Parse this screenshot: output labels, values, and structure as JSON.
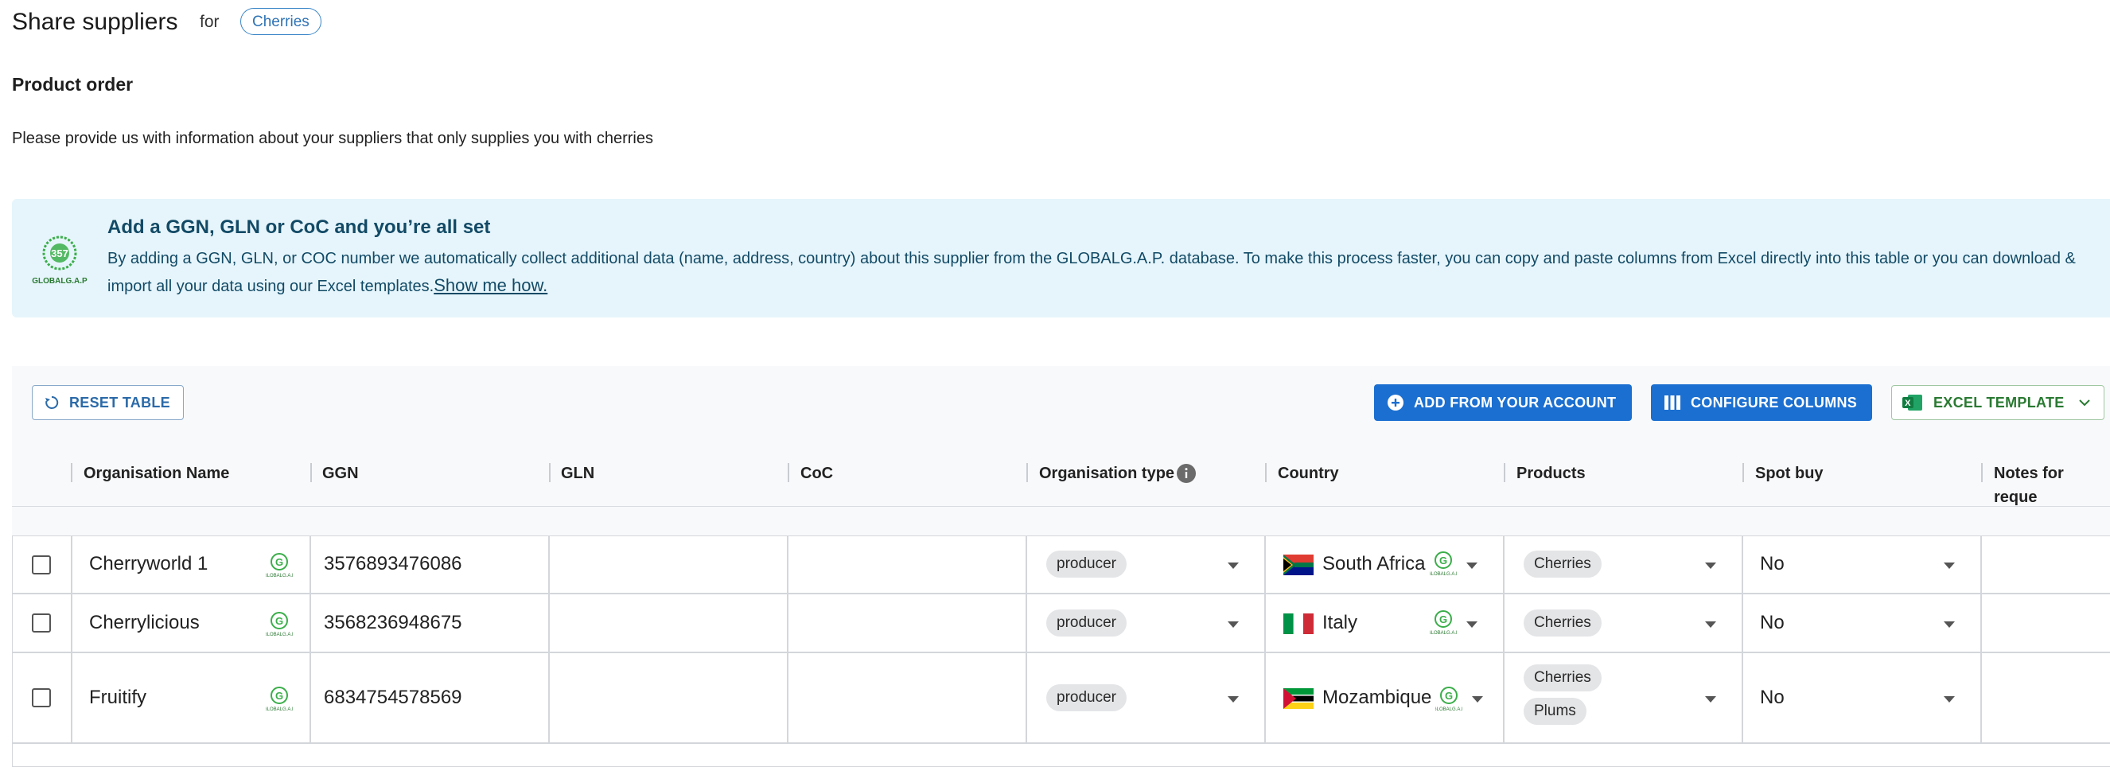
{
  "header": {
    "title": "Share suppliers",
    "for_label": "for",
    "product_chip": "Cherries"
  },
  "section": {
    "title": "Product order",
    "description": "Please provide us with information about your suppliers that only supplies you with cherries"
  },
  "banner": {
    "title": "Add a GGN, GLN or CoC and you’re all set",
    "text": "By adding a GGN, GLN, or COC number we automatically collect additional data (name, address, country) about this supplier from the GLOBALG.A.P. database. To make this process faster, you can copy and paste columns from Excel directly into this table or you can download & import all your data using our Excel templates.",
    "link": "Show me how.",
    "logo_text": "GLOBALG.A.P"
  },
  "toolbar": {
    "reset": "RESET TABLE",
    "add_from_account": "ADD FROM YOUR ACCOUNT",
    "configure_columns": "CONFIGURE COLUMNS",
    "excel_template": "EXCEL TEMPLATE"
  },
  "columns": [
    "Organisation Name",
    "GGN",
    "GLN",
    "CoC",
    "Organisation type",
    "Country",
    "Products",
    "Spot buy",
    "Notes for reque"
  ],
  "rows": [
    {
      "name": "Cherryworld 1",
      "ggn": "3576893476086",
      "gln": "",
      "coc": "",
      "org_type": "producer",
      "country": "South Africa",
      "products": [
        "Cherries"
      ],
      "spot_buy": "No"
    },
    {
      "name": "Cherrylicious",
      "ggn": "3568236948675",
      "gln": "",
      "coc": "",
      "org_type": "producer",
      "country": "Italy",
      "products": [
        "Cherries"
      ],
      "spot_buy": "No"
    },
    {
      "name": "Fruitify",
      "ggn": "6834754578569",
      "gln": "",
      "coc": "",
      "org_type": "producer",
      "country": "Mozambique",
      "products": [
        "Cherries",
        "Plums"
      ],
      "spot_buy": "No"
    }
  ],
  "colors": {
    "primary": "#1b6fd0",
    "banner_bg": "#e6f5fb",
    "banner_text": "#124a66",
    "excel_green": "#2a7a32",
    "globalgap_green": "#3aae49"
  }
}
